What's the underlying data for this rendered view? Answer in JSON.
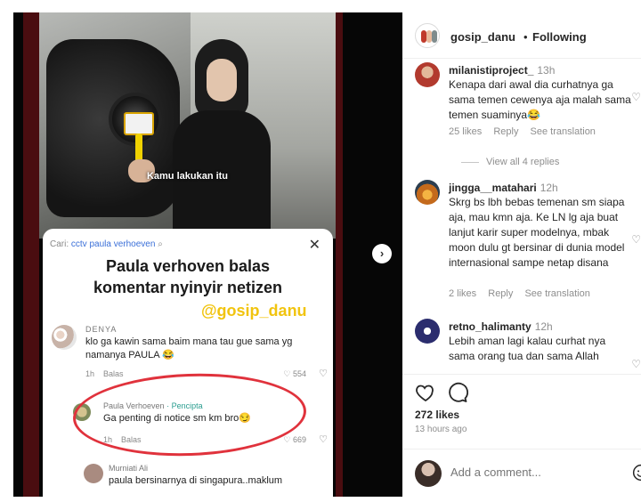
{
  "media": {
    "subtitle": "Kamu lakukan itu",
    "card": {
      "search_prefix": "Cari:",
      "search_query": "cctv paula verhoeven",
      "close": "✕",
      "title_line1": "Paula verhoven balas",
      "title_line2": "komentar nyinyir netizen",
      "watermark": "@gosip_danu",
      "comments": [
        {
          "user": "DENYA",
          "text": "klo ga kawin sama baim mana tau gue sama yg namanya PAULA 😂",
          "time": "1h",
          "reply": "Balas",
          "likes": "554"
        },
        {
          "user": "Paula Verhoeven",
          "badge": "· Pencipta",
          "text": "Ga penting di notice sm km bro😏",
          "time": "1h",
          "reply": "Balas",
          "likes": "669"
        },
        {
          "user": "Murniati Ali",
          "text": "paula bersinarnya di singapura..maklum"
        }
      ]
    },
    "next_icon": "›"
  },
  "post": {
    "username": "gosip_danu",
    "separator": "•",
    "follow_status": "Following",
    "comments": [
      {
        "user": "milanistiproject_",
        "time": "13h",
        "text": "Kenapa dari awal dia curhatnya ga sama temen cewenya aja malah sama temen suaminya😂",
        "likes": "25 likes",
        "reply": "Reply",
        "translate": "See translation",
        "view_replies": "View all 4 replies"
      },
      {
        "user": "jingga__matahari",
        "time": "12h",
        "text": "Skrg bs lbh bebas temenan sm siapa aja, mau kmn aja. Ke LN lg aja buat lanjut karir super modelnya, mbak moon dulu gt bersinar di dunia model internasional sampe netap disana",
        "likes": "2 likes",
        "reply": "Reply",
        "translate": "See translation"
      },
      {
        "user": "retno_halimanty",
        "time": "12h",
        "text": "Lebih aman lagi kalau curhat nya sama orang tua dan sama Allah"
      }
    ],
    "likes_count": "272 likes",
    "posted_ago": "13 hours ago",
    "add_comment_placeholder": "Add a comment...",
    "icons": {
      "like": "heart-icon",
      "comment": "comment-icon",
      "emoji": "emoji-icon"
    }
  }
}
